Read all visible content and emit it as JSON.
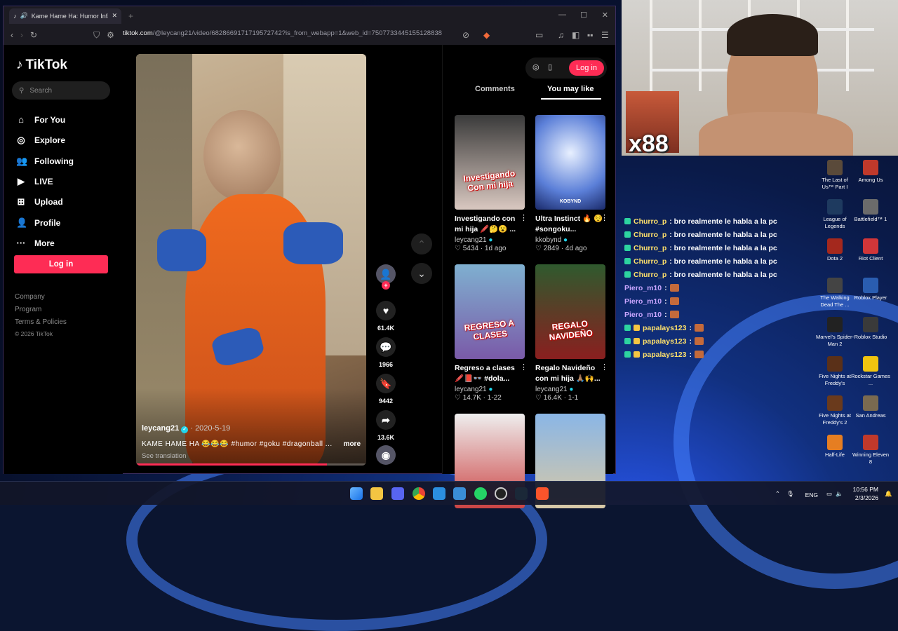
{
  "browser": {
    "tab_title": "Kame Hame Ha: Humor Infan",
    "url_host": "tiktok.com",
    "url_path": "/@leycang21/video/6828669171719572742?is_from_webapp=1&web_id=7507733445155128838"
  },
  "sidebar": {
    "logo": "TikTok",
    "search_placeholder": "Search",
    "items": [
      {
        "label": "For You",
        "icon": "home-icon"
      },
      {
        "label": "Explore",
        "icon": "compass-icon"
      },
      {
        "label": "Following",
        "icon": "users-icon"
      },
      {
        "label": "LIVE",
        "icon": "live-icon"
      },
      {
        "label": "Upload",
        "icon": "plus-square-icon"
      },
      {
        "label": "Profile",
        "icon": "user-icon"
      },
      {
        "label": "More",
        "icon": "dots-icon"
      }
    ],
    "login": "Log in",
    "footer": [
      "Company",
      "Program",
      "Terms & Policies",
      "© 2026 TikTok"
    ]
  },
  "video": {
    "author": "leycang21",
    "date": "2020-5-19",
    "caption": "KAME HAME HA 😂😂😂 #humor #goku #dragonball ...",
    "more": "more",
    "translate": "See translation",
    "progress": 0.83
  },
  "actions": {
    "likes": "61.4K",
    "comments": "1966",
    "saves": "9442",
    "shares": "13.6K"
  },
  "right": {
    "login": "Log in",
    "tabs": [
      "Comments",
      "You may like"
    ],
    "cards": [
      {
        "title": "Investigando con mi hija 🖍️🤔😮 ...",
        "author": "leycang21",
        "stat": "5434",
        "time": "1d ago",
        "overlay": "Investigando Con mi hija"
      },
      {
        "title": "Ultra Instinct 🔥 😌 #songoku...",
        "author": "kkobynd",
        "stat": "2849",
        "time": "4d ago",
        "overlay": "KOBYND"
      },
      {
        "title": "Regreso a clases 🖍️📕👓 #dola...",
        "author": "leycang21",
        "stat": "14.7K",
        "time": "1-22",
        "overlay": "REGRESO A CLASES"
      },
      {
        "title": "Regalo Navideño con mi hija 🙏🏽🙌...",
        "author": "leycang21",
        "stat": "16.4K",
        "time": "1-1",
        "overlay": "REGALO NAVIDEÑO"
      },
      {
        "title": "",
        "author": "",
        "stat": "",
        "time": "",
        "overlay": ""
      },
      {
        "title": "",
        "author": "",
        "stat": "",
        "time": "",
        "overlay": ""
      }
    ]
  },
  "stream": {
    "meme_count": "x88",
    "chat": [
      {
        "user": "Churro_p",
        "msg": ": bro realmente le habla a la pc"
      },
      {
        "user": "Churro_p",
        "msg": ": bro realmente le habla a la pc"
      },
      {
        "user": "Churro_p",
        "msg": ": bro realmente le habla a la pc"
      },
      {
        "user": "Churro_p",
        "msg": ": bro realmente le habla a la pc"
      },
      {
        "user": "Churro_p",
        "msg": ": bro realmente le habla a la pc"
      },
      {
        "user": "Piero_m10",
        "msg": ":"
      },
      {
        "user": "Piero_m10",
        "msg": ":"
      },
      {
        "user": "Piero_m10",
        "msg": ":"
      },
      {
        "user": "papalays123",
        "msg": ":"
      },
      {
        "user": "papalays123",
        "msg": ":"
      },
      {
        "user": "papalays123",
        "msg": ":"
      }
    ]
  },
  "desktop_icons": [
    {
      "label": "The Last of Us™ Part I",
      "color": "#5a4a3a"
    },
    {
      "label": "Among Us",
      "color": "#c0392b"
    },
    {
      "label": "League of Legends",
      "color": "#1e3a5f"
    },
    {
      "label": "Battlefield™ 1",
      "color": "#6b6b6b"
    },
    {
      "label": "Dota 2",
      "color": "#a4281d"
    },
    {
      "label": "Riot Client",
      "color": "#d13639"
    },
    {
      "label": "The Walking Dead The ...",
      "color": "#444444"
    },
    {
      "label": "Roblox Player",
      "color": "#2a5db0"
    },
    {
      "label": "Marvel's Spider-Man 2",
      "color": "#222222"
    },
    {
      "label": "Roblox Studio",
      "color": "#3a3a3a"
    },
    {
      "label": "Five Nights at Freddy's",
      "color": "#5a3018"
    },
    {
      "label": "Rockstar Games ...",
      "color": "#f1c40f"
    },
    {
      "label": "Five Nights at Freddy's 2",
      "color": "#6a3a1c"
    },
    {
      "label": "San Andreas",
      "color": "#7a6a50"
    },
    {
      "label": "Half-Life",
      "color": "#e67e22"
    },
    {
      "label": "Winning Eleven 8",
      "color": "#c0392b"
    }
  ],
  "taskbar": {
    "lang": "ENG",
    "time": "10:56 PM",
    "date": "2/3/2026"
  }
}
